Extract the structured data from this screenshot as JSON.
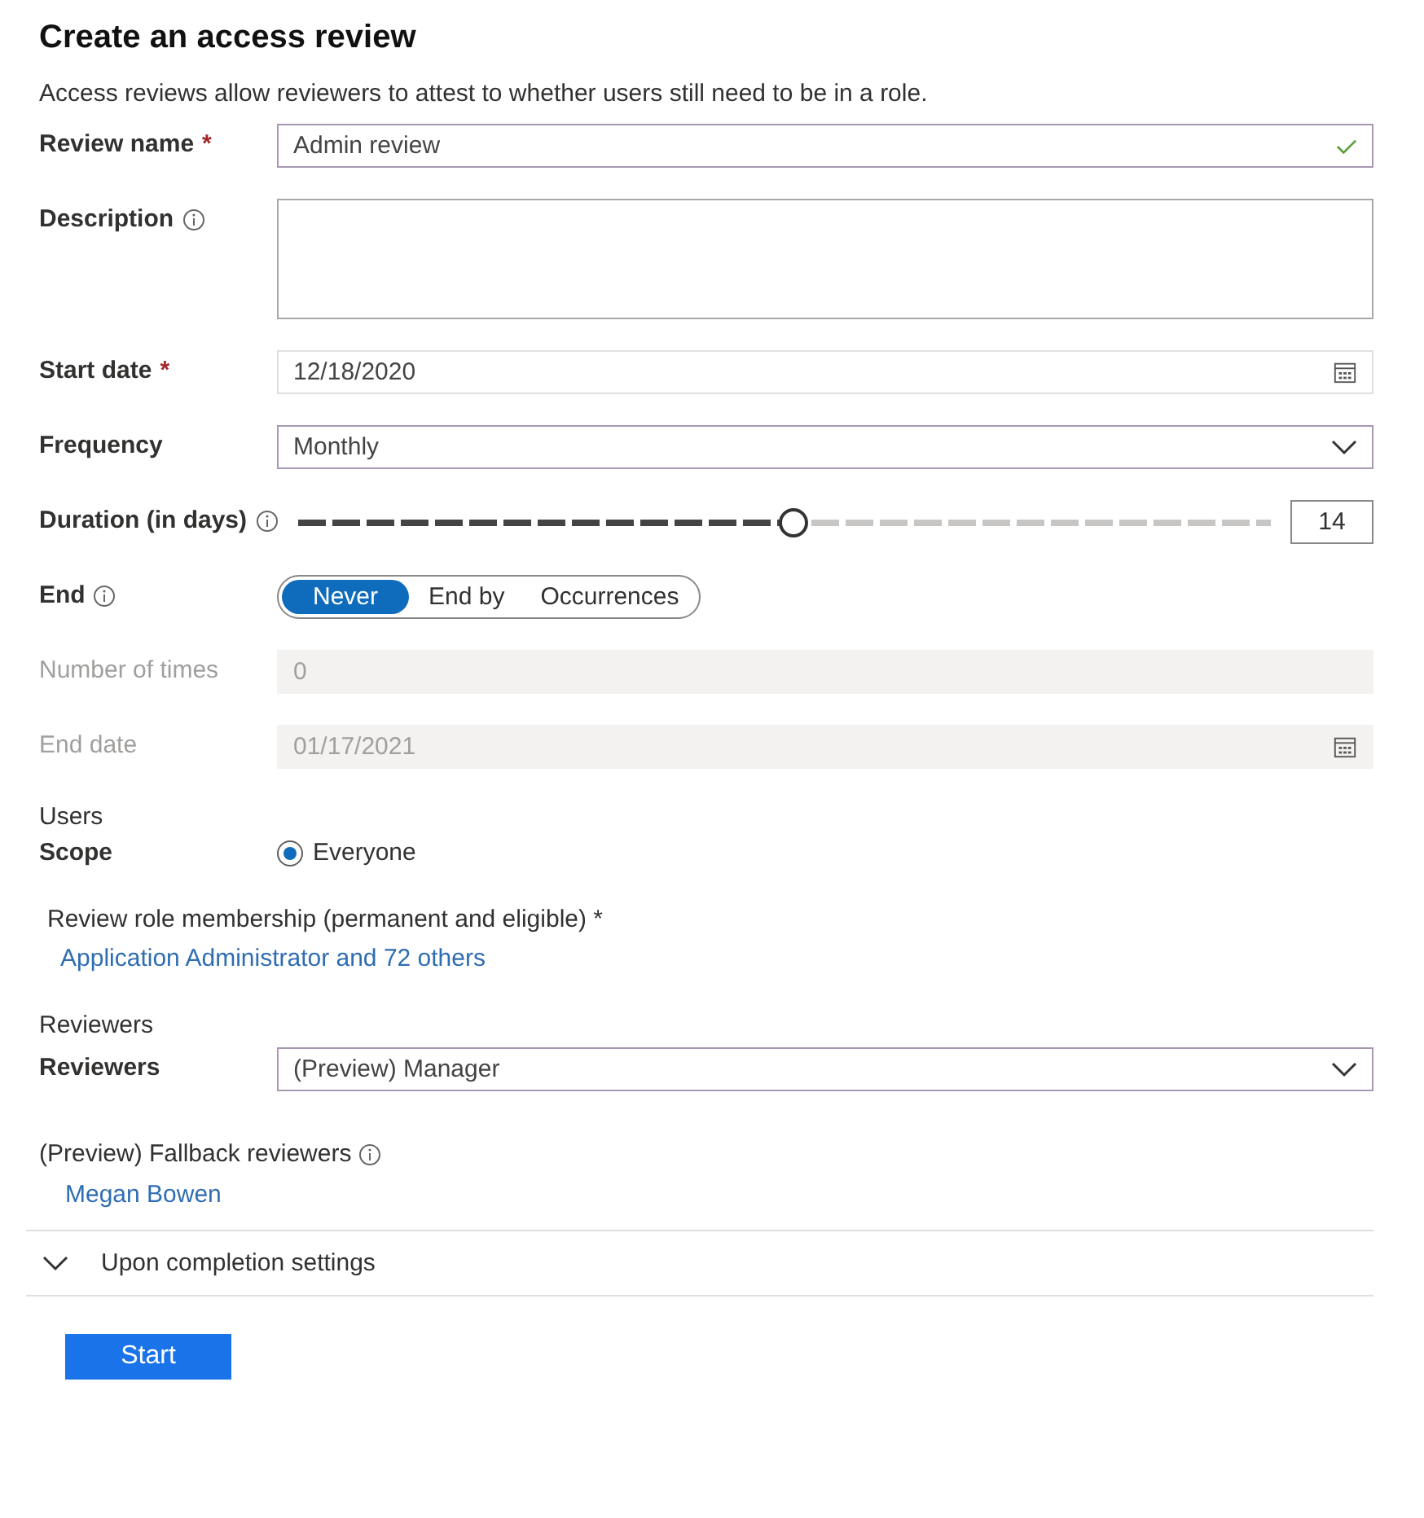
{
  "title": "Create an access review",
  "description": "Access reviews allow reviewers to attest to whether users still need to be in a role.",
  "fields": [
    {
      "kind": "text",
      "label": "Review name",
      "required_mark": "*",
      "value": "Admin review",
      "valid": true,
      "disabled": false
    },
    {
      "kind": "textarea",
      "label": "Description",
      "info": true
    },
    {
      "kind": "date",
      "label": "Start date",
      "required_mark": "*",
      "value": "12/18/2020",
      "disabled": false
    },
    {
      "kind": "dropdown",
      "label": "Frequency",
      "value": "Monthly"
    },
    {
      "kind": "slider",
      "label": "Duration (in days)",
      "info": true,
      "level": 0.51,
      "value": "14"
    },
    {
      "kind": "toggle",
      "label": "End",
      "info": true,
      "options": [
        {
          "label": "Never",
          "selected": true
        },
        {
          "label": "End by",
          "selected": false
        },
        {
          "label": "Occurrences",
          "selected": false
        }
      ]
    },
    {
      "kind": "text",
      "label": "Number of times",
      "value": "0",
      "valid": false,
      "disabled": true
    },
    {
      "kind": "date",
      "label": "End date",
      "value": "01/17/2021",
      "disabled": true
    }
  ],
  "users": {
    "heading": "Users",
    "scope_label": "Scope",
    "scope_option": {
      "label": "Everyone",
      "selected": true
    },
    "membership_label": "Review role membership (permanent and eligible) *",
    "membership_link": "Application Administrator and 72 others"
  },
  "reviewers": {
    "heading": "Reviewers",
    "label": "Reviewers",
    "value": "(Preview) Manager",
    "fallback_label": "(Preview) Fallback reviewers",
    "fallback_info": true,
    "fallback_link": "Megan Bowen"
  },
  "completion": {
    "label": "Upon completion settings",
    "expanded": false
  },
  "start_button": "Start"
}
